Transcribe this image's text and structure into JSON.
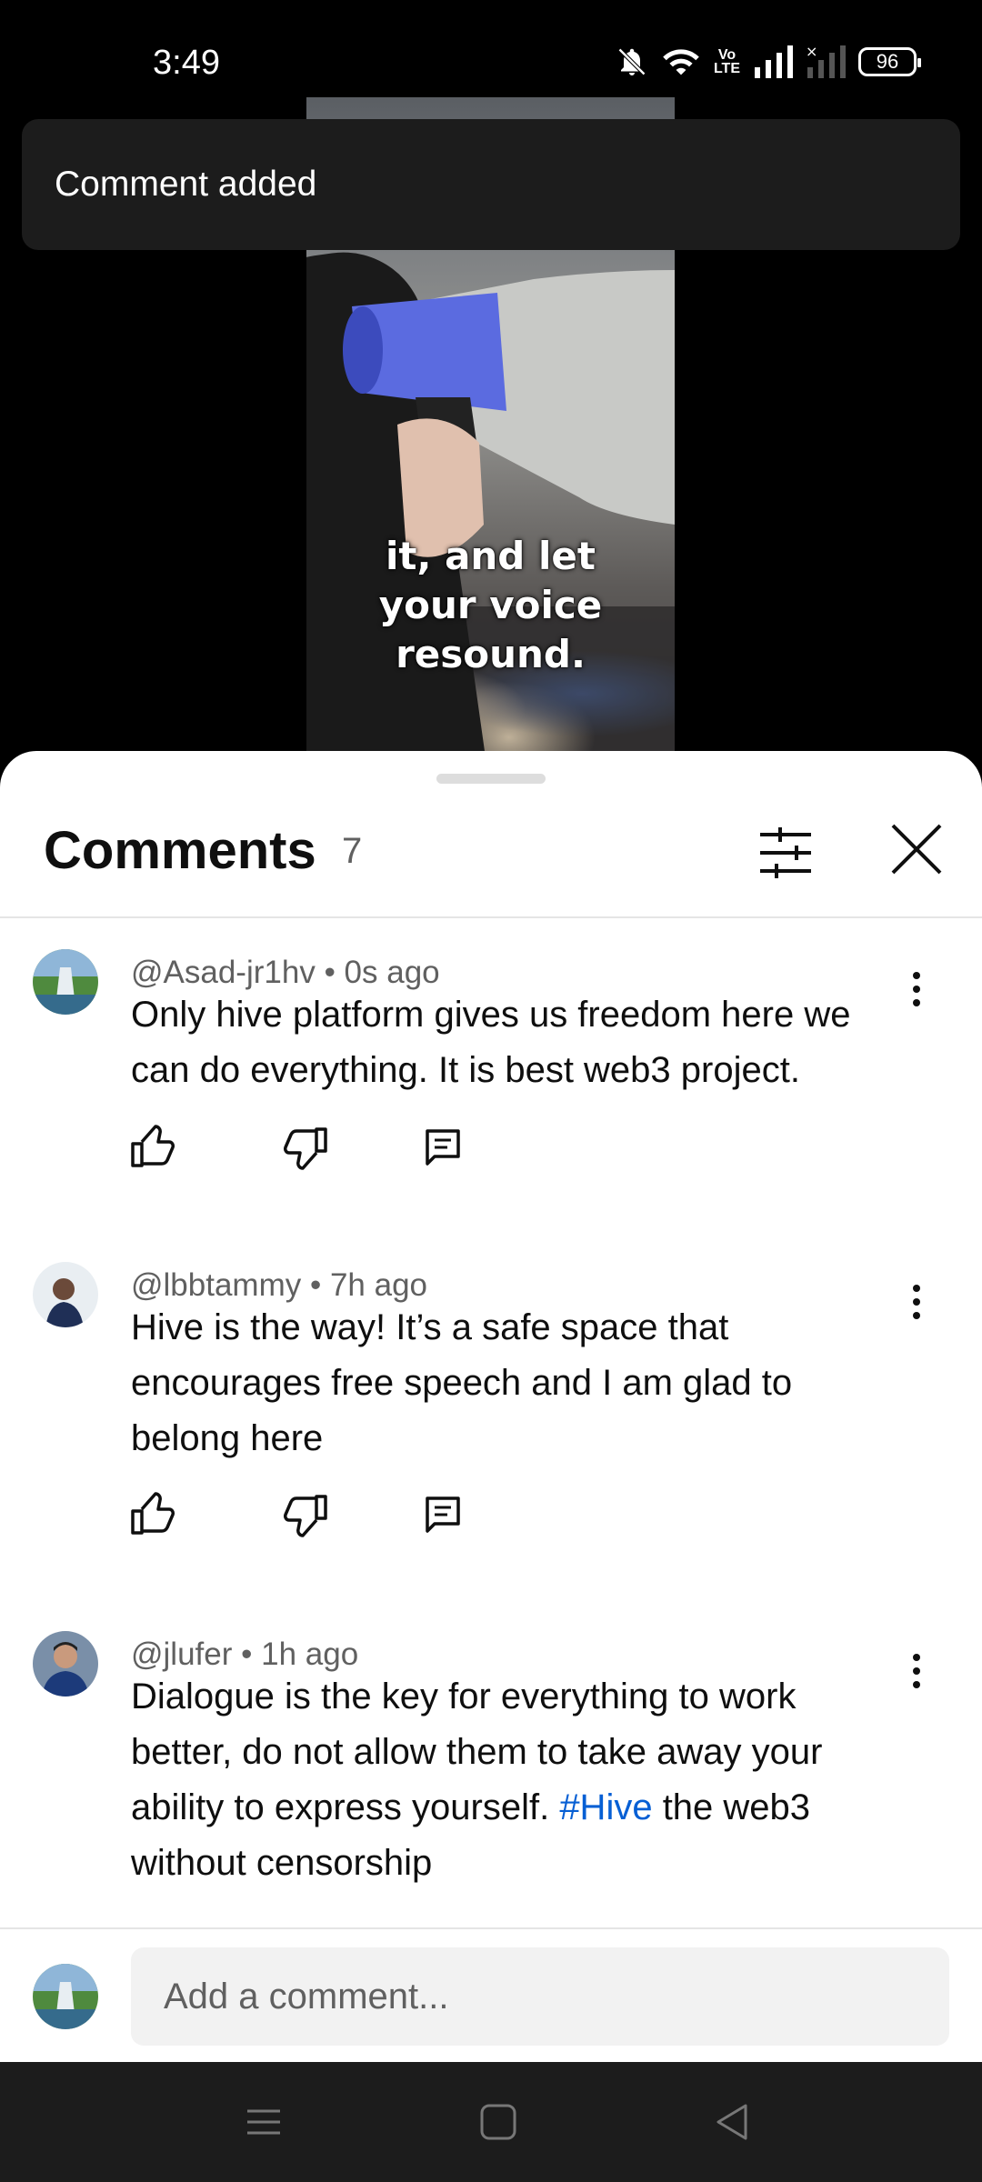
{
  "status_bar": {
    "time": "3:49",
    "volte": "Vo\nLTE",
    "battery": "96"
  },
  "video": {
    "caption": "it, and let your voice resound."
  },
  "toast": {
    "text": "Comment added"
  },
  "comments_panel": {
    "title": "Comments",
    "count": "7",
    "comments": [
      {
        "author": "@Asad-jr1hv",
        "time": "0s ago",
        "text": "Only hive platform gives us freedom here we can do everything. It is best web3 project."
      },
      {
        "author": "@lbbtammy",
        "time": "7h ago",
        "text": "Hive is the way! It’s a safe space that encourages free speech and I am glad to belong here"
      },
      {
        "author": "@jlufer",
        "time": "1h ago",
        "text_before": "Dialogue is the key for everything to work better, do not allow them to take away your ability to express yourself. ",
        "hashtag": "#Hive",
        "text_after": " the web3 without censorship"
      }
    ],
    "add_comment": {
      "placeholder": "Add a comment..."
    }
  },
  "colors": {
    "accent_link": "#065fd4",
    "text_primary": "#0f0f0f",
    "text_secondary": "#606060"
  }
}
